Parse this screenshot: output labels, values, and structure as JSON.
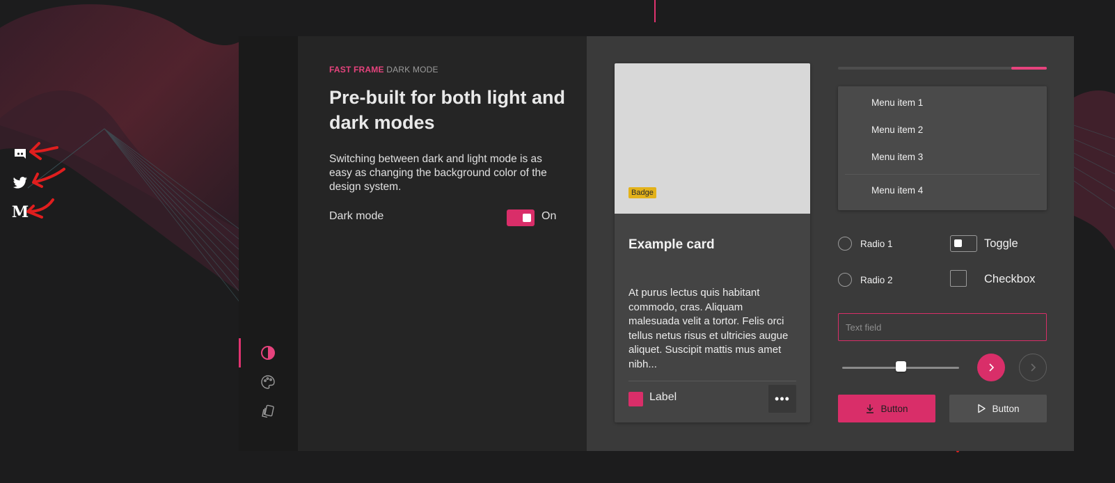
{
  "colors": {
    "accent": "#d92e69",
    "accent_light": "#e6437d",
    "badge": "#e3b21a"
  },
  "social": [
    "discord-icon",
    "twitter-icon",
    "medium-icon"
  ],
  "medium_letter": "M",
  "rail": {
    "items": [
      "contrast-icon",
      "palette-icon",
      "cards-icon"
    ],
    "active_index": 0
  },
  "hero": {
    "eyebrow_brand": "FAST FRAME",
    "eyebrow_rest": "DARK MODE",
    "headline": "Pre-built for both light and dark modes",
    "description": "Switching between dark and light mode is as easy as changing the background color of the design system.",
    "dark_mode_label": "Dark mode",
    "dark_mode_state": "On"
  },
  "card": {
    "badge": "Badge",
    "title": "Example card",
    "body": "At purus lectus quis habitant commodo, cras. Aliquam malesuada velit a tortor. Felis orci tellus netus risus et ultricies augue aliquet. Suscipit mattis mus amet nibh...",
    "label": "Label",
    "more": "•••"
  },
  "progress": {
    "start": 0.83,
    "end": 1.0
  },
  "menu": [
    "Menu item 1",
    "Menu item 2",
    "Menu item 3",
    "Menu item 4"
  ],
  "controls": {
    "radio1": "Radio 1",
    "radio2": "Radio 2",
    "toggle": "Toggle",
    "checkbox": "Checkbox",
    "text_field_placeholder": "Text field",
    "slider_value": 0.5
  },
  "buttons": {
    "primary": "Button",
    "secondary": "Button"
  }
}
